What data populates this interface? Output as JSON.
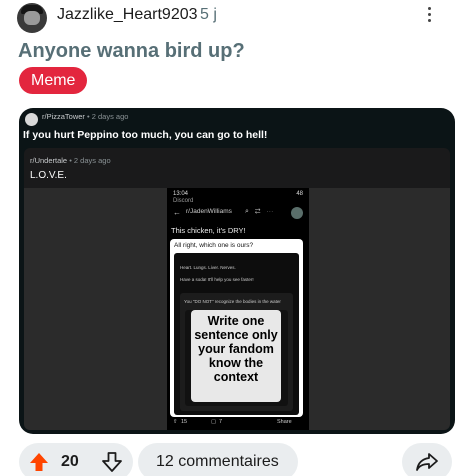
{
  "post": {
    "username": "Jazzlike_Heart9203",
    "time_ago": "5 j",
    "title": "Anyone wanna bird up?",
    "flair": "Meme"
  },
  "embed": {
    "subreddit": "r/PizzaTower",
    "time": "2 days ago",
    "title": "If you hurt Peppino too much, you can go to hell!",
    "inner": {
      "subreddit": "r/Undertale",
      "time": "2 days ago",
      "title": "L.O.V.E."
    },
    "phone": {
      "status_time": "13:04",
      "status_sub": "Discord",
      "battery": "48",
      "user": "r/JadenWilliams",
      "post_text": "This chicken, it's DRY!",
      "card_title": "All right, which one is ours?",
      "line1": "Heart. Lungs. Liver. Nerves.",
      "line2": "Have a soda! It'll help you see faster!",
      "line3": "You \"DO NOT\" recognize the bodies in the water",
      "meme_text": "Write one sentence only your fandom know the context",
      "upvotes": "15",
      "comments": "7",
      "share": "Share"
    }
  },
  "actions": {
    "score": "20",
    "comments_label": "12 commentaires"
  },
  "colors": {
    "flair_bg": "#e3263e",
    "upvote": "#ff4500",
    "muted_text": "#576f76",
    "pill_bg": "#eaedef"
  },
  "icons": [
    "more-options-icon",
    "upvote-arrow-icon",
    "downvote-arrow-icon",
    "comment-bubble-icon",
    "share-arrow-icon"
  ]
}
